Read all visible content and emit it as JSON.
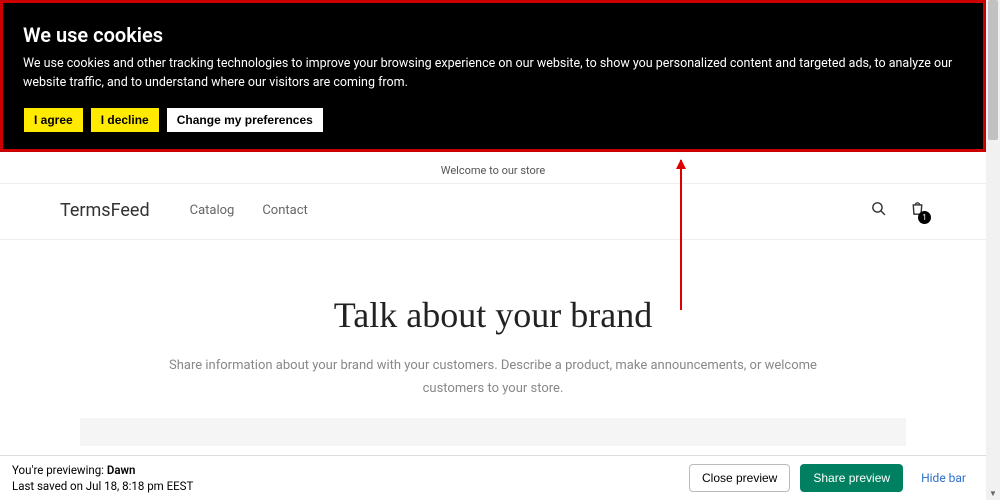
{
  "cookie": {
    "title": "We use cookies",
    "text": "We use cookies and other tracking technologies to improve your browsing experience on our website, to show you personalized content and targeted ads, to analyze our website traffic, and to understand where our visitors are coming from.",
    "agree": "I agree",
    "decline": "I decline",
    "prefs": "Change my preferences"
  },
  "announce": "Welcome to our store",
  "header": {
    "logo": "TermsFeed",
    "nav": {
      "catalog": "Catalog",
      "contact": "Contact"
    },
    "cart_count": "1"
  },
  "hero": {
    "title": "Talk about your brand",
    "sub": "Share information about your brand with your customers. Describe a product, make announcements, or welcome customers to your store."
  },
  "preview": {
    "label": "You're previewing: ",
    "theme": "Dawn",
    "saved": "Last saved on Jul 18, 8:18 pm EEST",
    "close": "Close preview",
    "share": "Share preview",
    "hide": "Hide bar"
  }
}
